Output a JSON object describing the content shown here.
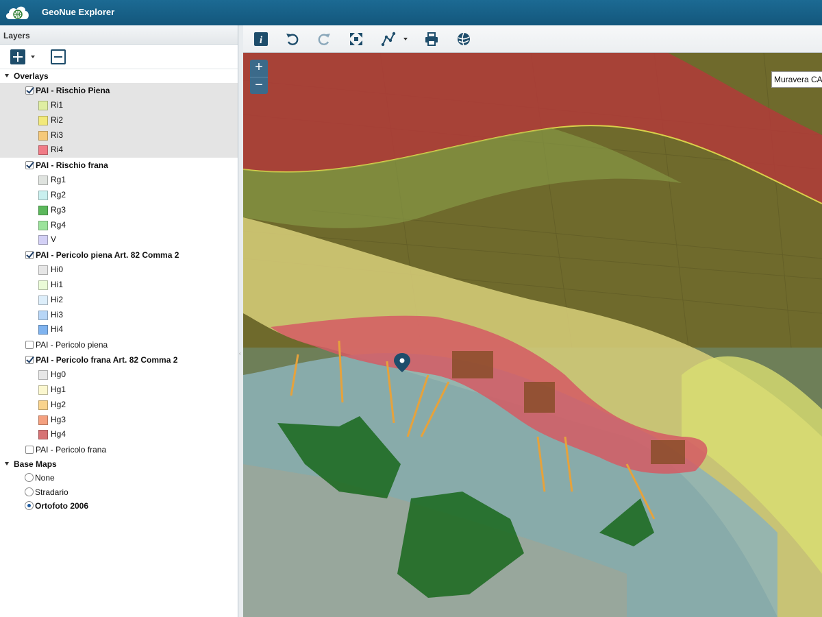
{
  "app": {
    "title": "GeoNue Explorer"
  },
  "layers_panel": {
    "title": "Layers",
    "overlays_label": "Overlays",
    "base_maps_label": "Base Maps",
    "overlays": [
      {
        "name": "PAI - Rischio Piena",
        "checked": true,
        "selected": true,
        "legend": [
          {
            "label": "Ri1",
            "color": "#dfeea2"
          },
          {
            "label": "Ri2",
            "color": "#f2e97a"
          },
          {
            "label": "Ri3",
            "color": "#f5c97a"
          },
          {
            "label": "Ri4",
            "color": "#f07b86"
          }
        ]
      },
      {
        "name": "PAI - Rischio frana",
        "checked": true,
        "legend": [
          {
            "label": "Rg1",
            "color": "#dfe3df"
          },
          {
            "label": "Rg2",
            "color": "#c9f0ef"
          },
          {
            "label": "Rg3",
            "color": "#5cb85c"
          },
          {
            "label": "Rg4",
            "color": "#9be39b"
          },
          {
            "label": "V",
            "color": "#d3d0f5"
          }
        ]
      },
      {
        "name": "PAI - Pericolo piena Art. 82 Comma 2",
        "checked": true,
        "legend": [
          {
            "label": "Hi0",
            "color": "#e6e6e6"
          },
          {
            "label": "Hi1",
            "color": "#eafbd7"
          },
          {
            "label": "Hi2",
            "color": "#ddeefa"
          },
          {
            "label": "Hi3",
            "color": "#b7d6f7"
          },
          {
            "label": "Hi4",
            "color": "#7fb3ef"
          }
        ]
      },
      {
        "name": "PAI - Pericolo piena",
        "checked": false,
        "legend": []
      },
      {
        "name": "PAI - Pericolo frana Art. 82 Comma 2",
        "checked": true,
        "legend": [
          {
            "label": "Hg0",
            "color": "#e6e6e6"
          },
          {
            "label": "Hg1",
            "color": "#fbf7cf"
          },
          {
            "label": "Hg2",
            "color": "#f9d38c"
          },
          {
            "label": "Hg3",
            "color": "#f4a07f"
          },
          {
            "label": "Hg4",
            "color": "#d77274"
          }
        ]
      },
      {
        "name": "PAI - Pericolo frana",
        "checked": false,
        "legend": []
      }
    ],
    "base_maps": [
      {
        "name": "None",
        "selected": false
      },
      {
        "name": "Stradario",
        "selected": false
      },
      {
        "name": "Ortofoto 2006",
        "selected": true
      }
    ]
  },
  "toolbar": {
    "tools": [
      {
        "icon": "info-icon"
      },
      {
        "icon": "undo-icon"
      },
      {
        "icon": "redo-icon"
      },
      {
        "icon": "zoom-extent-icon"
      },
      {
        "icon": "measure-icon"
      },
      {
        "icon": "print-icon"
      },
      {
        "icon": "globe-icon"
      }
    ]
  },
  "map": {
    "zoom_in": "+",
    "zoom_out": "−",
    "place_label": "Muravera CA"
  }
}
